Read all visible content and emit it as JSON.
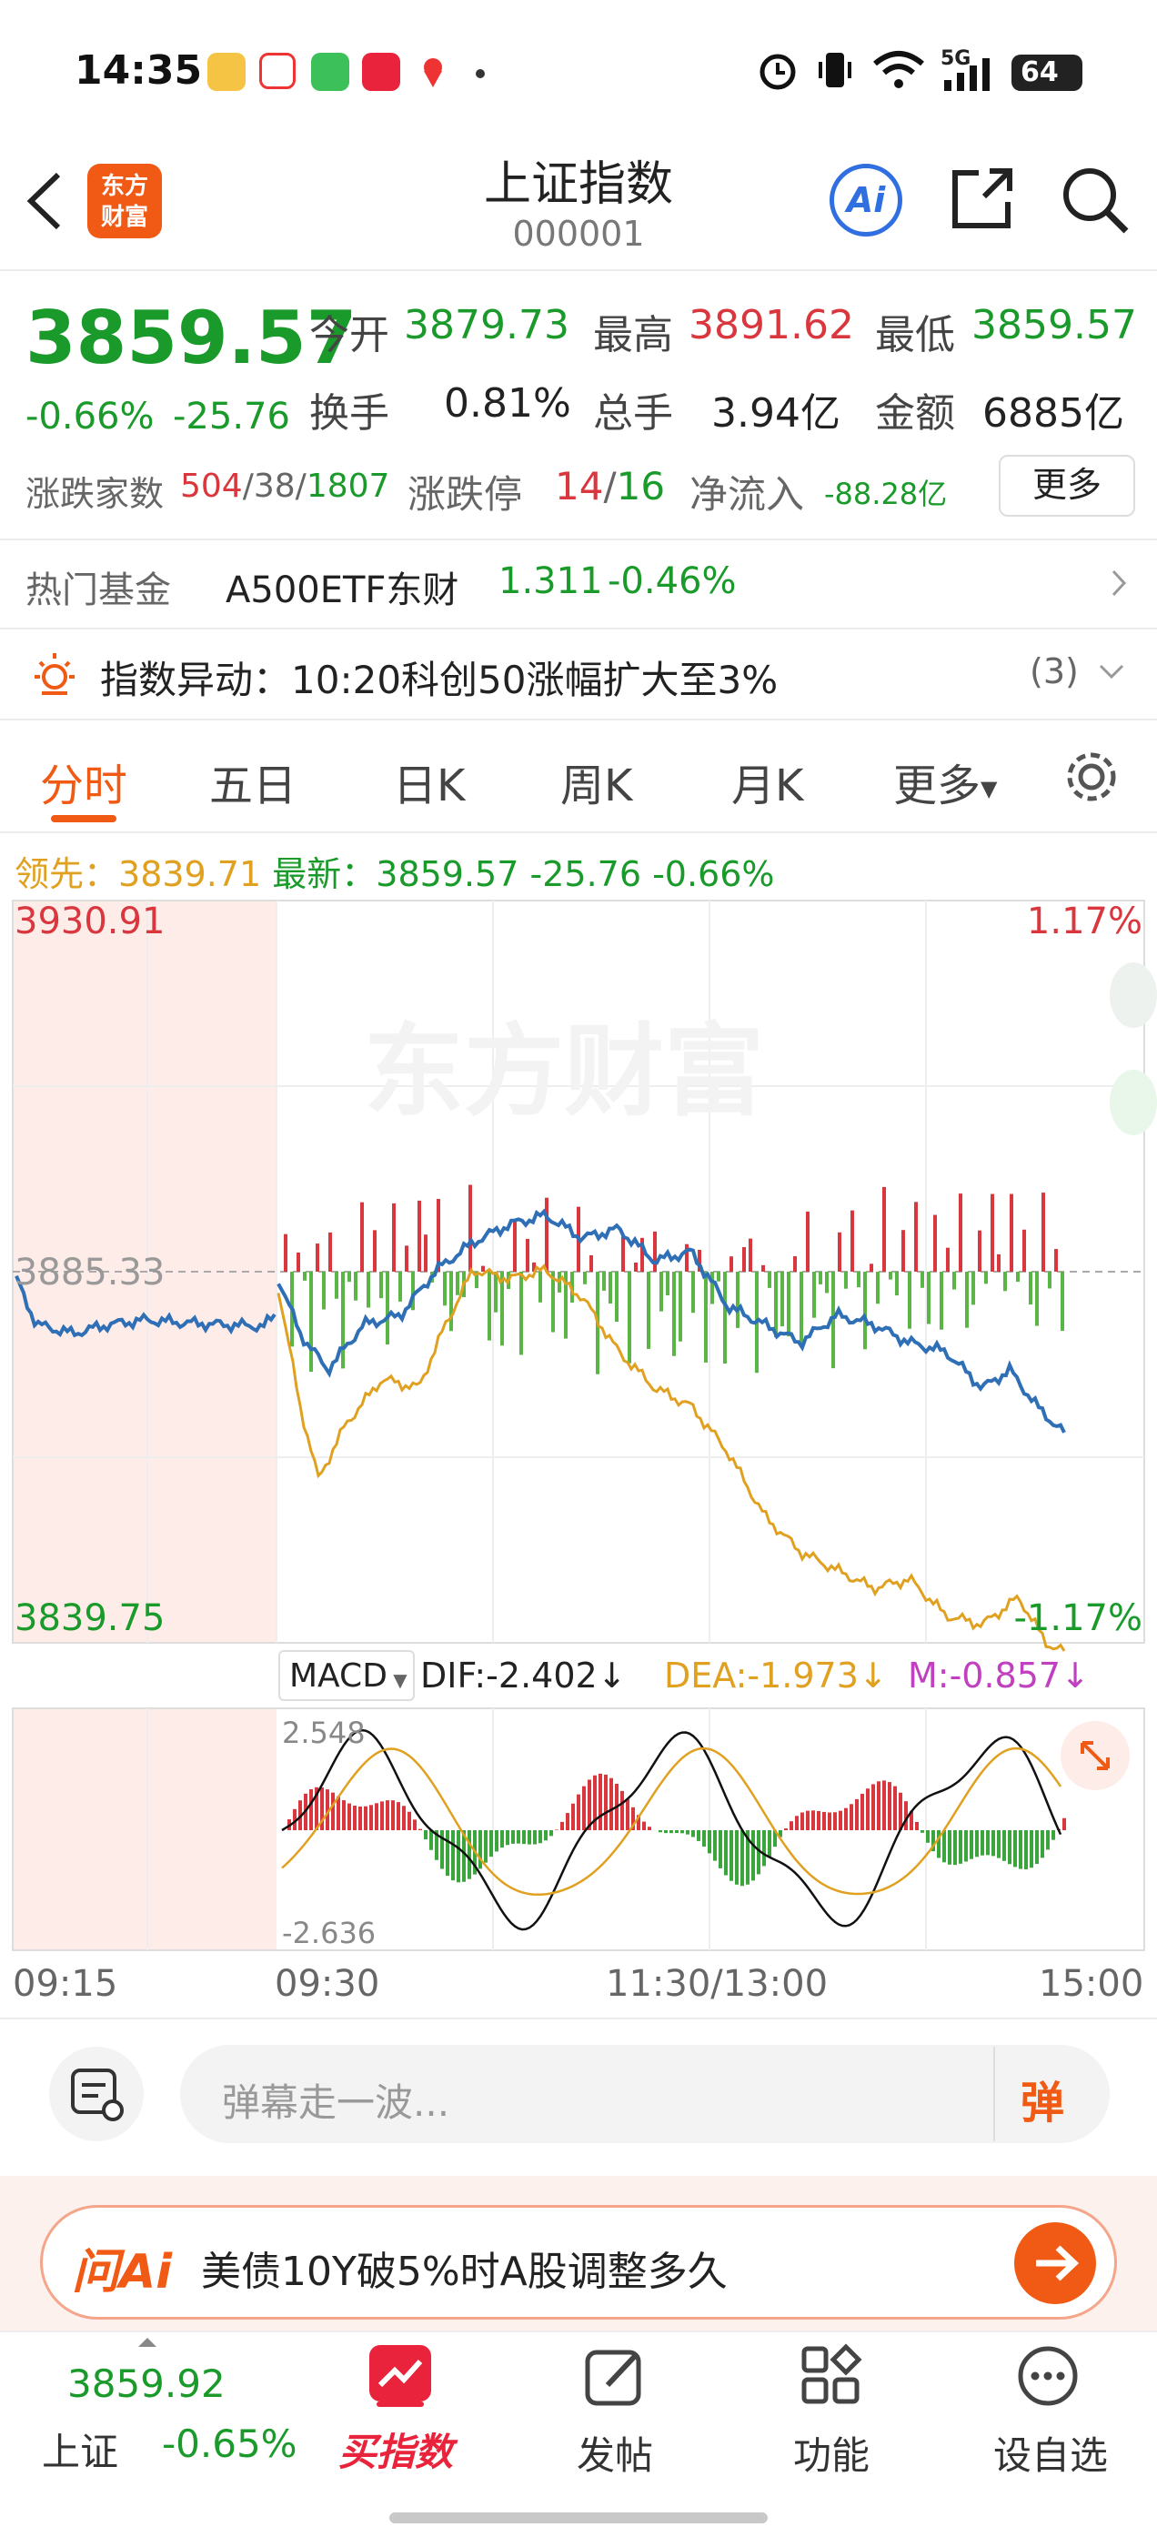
{
  "status_bar": {
    "time": "14:35",
    "signal": "5G",
    "battery": "64"
  },
  "header": {
    "title": "上证指数",
    "code": "000001",
    "logo_line1": "东方",
    "logo_line2": "财富",
    "ai_label": "Ai"
  },
  "quote": {
    "price": "3859.57",
    "change_pct": "-0.66%",
    "change": "-25.76",
    "open_label": "今开",
    "open": "3879.73",
    "high_label": "最高",
    "high": "3891.62",
    "low_label": "最低",
    "low": "3859.57",
    "turnover_label": "换手",
    "turnover": "0.81%",
    "volume_label": "总手",
    "volume": "3.94亿",
    "amount_label": "金额",
    "amount": "6885亿",
    "breadth_label": "涨跌家数",
    "breadth_up": "504",
    "breadth_flat": "38",
    "breadth_down": "1807",
    "limit_label": "涨跌停",
    "limit_up": "14",
    "limit_down": "16",
    "netflow_label": "净流入",
    "netflow": "-88.28亿",
    "more_label": "更多"
  },
  "hot_fund": {
    "label": "热门基金",
    "name": "A500ETF东财",
    "price": "1.311",
    "change": "-0.46%"
  },
  "alert": {
    "text": "指数异动：10:20科创50涨幅扩大至3%",
    "count": "(3)"
  },
  "tabs": [
    "分时",
    "五日",
    "日K",
    "周K",
    "月K",
    "更多"
  ],
  "chart_info": {
    "lead_label": "领先：",
    "lead_value": "3839.71",
    "latest_label": "最新：",
    "latest_value": "3859.57",
    "latest_change": "-25.76",
    "latest_pct": "-0.66%"
  },
  "chart_labels": {
    "top": "3930.91",
    "mid": "3885.33",
    "bottom": "3839.75",
    "top_pct": "1.17%",
    "bottom_pct": "-1.17%",
    "watermark": "东方财富"
  },
  "macd": {
    "label": "MACD",
    "dif": "DIF:-2.402",
    "dea": "DEA:-1.973",
    "m": "M:-0.857",
    "top": "2.548",
    "bottom": "-2.636"
  },
  "time_axis": [
    "09:15",
    "09:30",
    "11:30/13:00",
    "15:00"
  ],
  "comment": {
    "placeholder": "弹幕走一波...",
    "danmu_label": "弹"
  },
  "ai_bar": {
    "brand": "问Ai",
    "text": "美债10Y破5%时A股调整多久"
  },
  "bottom_nav": {
    "index_value": "3859.92",
    "index_name": "上证",
    "index_change": "-0.65%",
    "buy": "买指数",
    "post": "发帖",
    "func": "功能",
    "watch": "设自选"
  },
  "colors": {
    "up": "#d9363e",
    "down": "#1a9a2a",
    "accent": "#f05a14",
    "avg_line": "#e0a020",
    "price_line": "#2f6fb6"
  },
  "chart_data": [
    {
      "type": "line",
      "x": [
        "09:15",
        "09:30",
        "11:30/13:00",
        "15:00"
      ],
      "ylim": [
        3839.75,
        3930.91
      ],
      "series": [],
      "grid": true
    },
    {
      "type": "bar",
      "ylim": [
        -2.636,
        2.548
      ],
      "series": [
        {
          "name": "DIF",
          "values": [
            -2.402
          ]
        },
        {
          "name": "DEA",
          "values": [
            -1.973
          ]
        },
        {
          "name": "M",
          "values": [
            -0.857
          ]
        }
      ]
    }
  ]
}
